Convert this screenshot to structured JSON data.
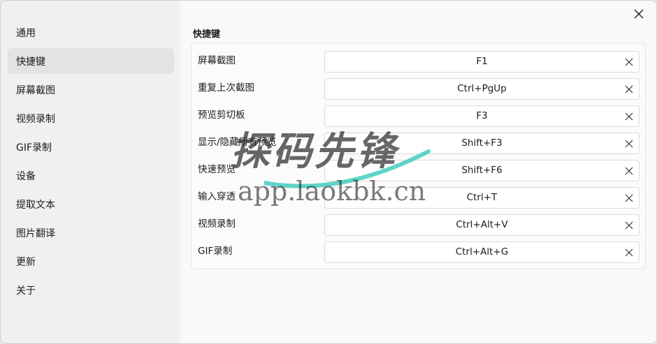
{
  "sidebar": {
    "items": [
      {
        "label": "通用",
        "active": false
      },
      {
        "label": "快捷键",
        "active": true
      },
      {
        "label": "屏幕截图",
        "active": false
      },
      {
        "label": "视频录制",
        "active": false
      },
      {
        "label": "GIF录制",
        "active": false
      },
      {
        "label": "设备",
        "active": false
      },
      {
        "label": "提取文本",
        "active": false
      },
      {
        "label": "图片翻译",
        "active": false
      },
      {
        "label": "更新",
        "active": false
      },
      {
        "label": "关于",
        "active": false
      }
    ]
  },
  "main": {
    "section_title": "快捷键",
    "hotkeys": [
      {
        "label": "屏幕截图",
        "value": "F1"
      },
      {
        "label": "重复上次截图",
        "value": "Ctrl+PgUp"
      },
      {
        "label": "预览剪切板",
        "value": "F3"
      },
      {
        "label": "显示/隐藏所有预览",
        "value": "Shift+F3"
      },
      {
        "label": "快速预览",
        "value": "Shift+F6"
      },
      {
        "label": "输入穿透",
        "value": "Ctrl+T"
      },
      {
        "label": "视频录制",
        "value": "Ctrl+Alt+V"
      },
      {
        "label": "GIF录制",
        "value": "Ctrl+Alt+G"
      }
    ]
  },
  "watermark": {
    "main_text": "探码先锋",
    "sub_text": "app.laokbk.cn"
  },
  "icons": {
    "close": "close-icon",
    "clear": "clear-icon"
  },
  "colors": {
    "sidebar_bg": "#f0f0f0",
    "active_item_bg": "#e3e3e3",
    "content_bg": "#f9f9f9",
    "watermark_accent": "#5fd3c8"
  }
}
